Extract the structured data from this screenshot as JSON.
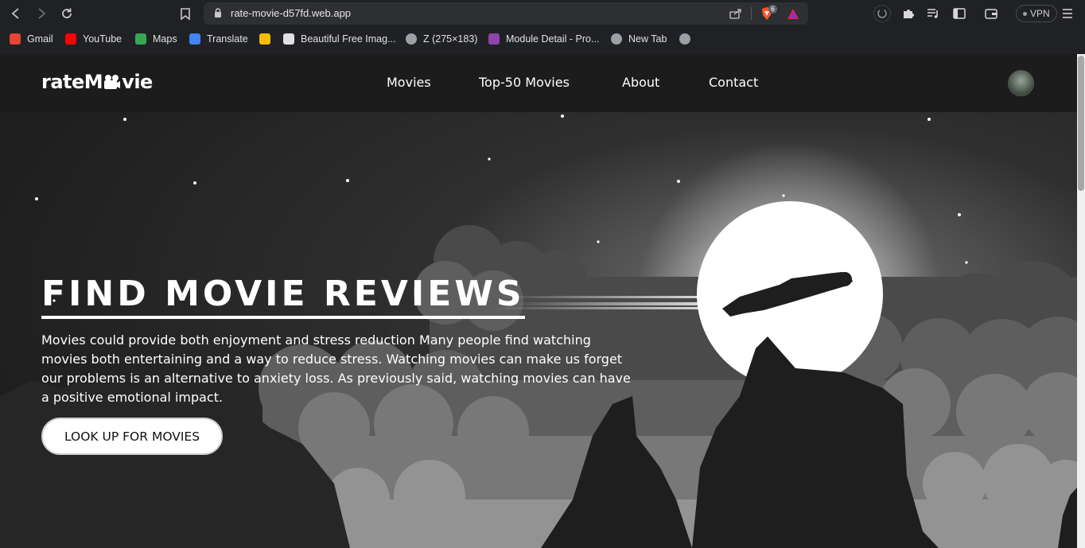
{
  "browser": {
    "url": "rate-movie-d57fd.web.app",
    "vpn_label": "VPN",
    "brave_badge": "6",
    "bookmarks": [
      {
        "label": "Gmail",
        "icon": "gmail-icon",
        "color": "#ea4335"
      },
      {
        "label": "YouTube",
        "icon": "youtube-icon",
        "color": "#ff0000"
      },
      {
        "label": "Maps",
        "icon": "maps-icon",
        "color": "#34a853"
      },
      {
        "label": "Translate",
        "icon": "translate-icon",
        "color": "#4285f4"
      },
      {
        "label": "",
        "icon": "drive-icon",
        "color": "#fbbc04"
      },
      {
        "label": "Beautiful Free Imag...",
        "icon": "image-site-icon",
        "color": "#e0e0e0"
      },
      {
        "label": "Z (275×183)",
        "icon": "globe-icon",
        "color": "#9aa0a6"
      },
      {
        "label": "Module Detail - Pro...",
        "icon": "module-icon",
        "color": "#8e44ad"
      },
      {
        "label": "New Tab",
        "icon": "globe-icon",
        "color": "#9aa0a6"
      },
      {
        "label": "",
        "icon": "globe-icon",
        "color": "#9aa0a6"
      }
    ]
  },
  "site": {
    "logo": "rateM…vie",
    "logo_parts": {
      "before": "rateM",
      "after": "vie"
    },
    "nav": [
      "Movies",
      "Top-50 Movies",
      "About",
      "Contact"
    ],
    "hero": {
      "title": "FIND MOVIE REVIEWS",
      "text": "Movies could provide both enjoyment and stress reduction Many people find watching movies both entertaining and a way to reduce stress. Watching movies can make us forget our problems is an alternative to anxiety loss. As previously said, watching movies can have a positive emotional impact.",
      "cta": "LOOK UP FOR MOVIES"
    }
  },
  "colors": {
    "accent": "#ffffff",
    "nav_bg": "#1c1c1c",
    "browser_bg": "#202124"
  }
}
